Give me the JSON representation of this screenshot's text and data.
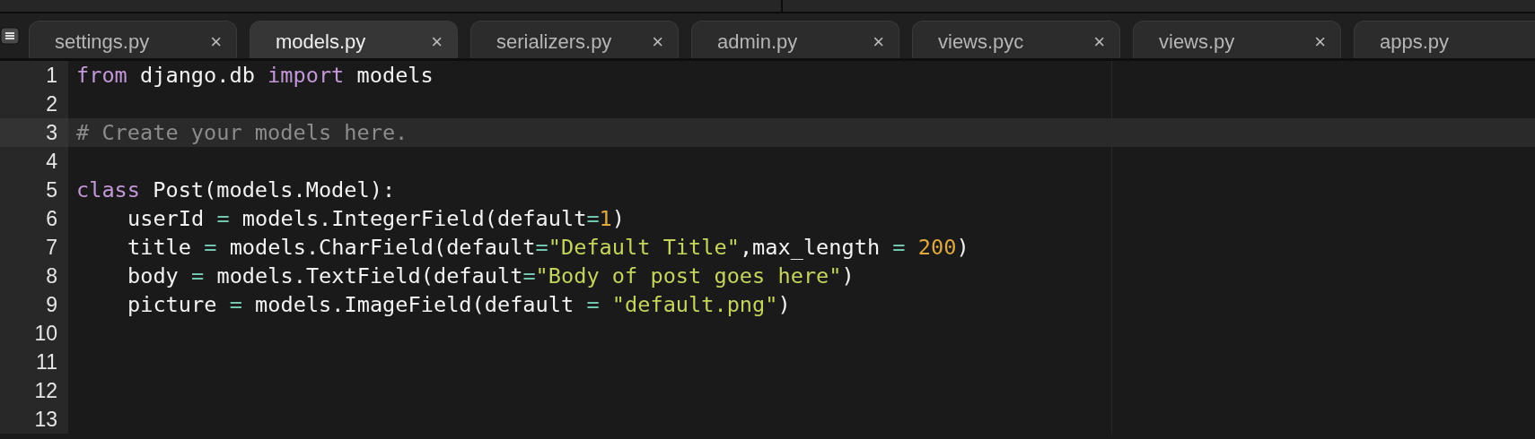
{
  "tabs": [
    {
      "label": "settings.py",
      "close": "×",
      "selected": false
    },
    {
      "label": "models.py",
      "close": "×",
      "selected": true
    },
    {
      "label": "serializers.py",
      "close": "×",
      "selected": false
    },
    {
      "label": "admin.py",
      "close": "×",
      "selected": false
    },
    {
      "label": "views.pyc",
      "close": "×",
      "selected": false
    },
    {
      "label": "views.py",
      "close": "×",
      "selected": false
    },
    {
      "label": "apps.py",
      "selected": false
    }
  ],
  "editor": {
    "lines": [
      {
        "number": "1",
        "current": false,
        "indented": false,
        "tokens": [
          {
            "kind": "keyword",
            "text": "from"
          },
          {
            "kind": "plain",
            "text": " django.db "
          },
          {
            "kind": "keyword",
            "text": "import"
          },
          {
            "kind": "plain",
            "text": " models"
          }
        ]
      },
      {
        "number": "2",
        "current": false
      },
      {
        "number": "3",
        "current": true,
        "indented": false,
        "tokens": [
          {
            "kind": "comment",
            "text": "# Create your models here."
          }
        ]
      },
      {
        "number": "4",
        "current": false
      },
      {
        "number": "5",
        "current": false,
        "indented": false,
        "tokens": [
          {
            "kind": "keyword",
            "text": "class"
          },
          {
            "kind": "plain",
            "text": " Post(models.Model):"
          }
        ]
      },
      {
        "number": "6",
        "current": false,
        "indented": true,
        "tokens": [
          {
            "kind": "plain",
            "text": "userId "
          },
          {
            "kind": "operator",
            "text": "="
          },
          {
            "kind": "plain",
            "text": " models.IntegerField(default"
          },
          {
            "kind": "operator",
            "text": "="
          },
          {
            "kind": "number",
            "text": "1"
          },
          {
            "kind": "plain",
            "text": ")"
          }
        ]
      },
      {
        "number": "7",
        "current": false,
        "indented": true,
        "tokens": [
          {
            "kind": "plain",
            "text": "title "
          },
          {
            "kind": "operator",
            "text": "="
          },
          {
            "kind": "plain",
            "text": " models.CharField(default"
          },
          {
            "kind": "operator",
            "text": "="
          },
          {
            "kind": "string",
            "text": "\"Default Title\""
          },
          {
            "kind": "plain",
            "text": ",max_length "
          },
          {
            "kind": "operator",
            "text": "= "
          },
          {
            "kind": "number",
            "text": "200"
          },
          {
            "kind": "plain",
            "text": ")"
          }
        ]
      },
      {
        "number": "8",
        "current": false,
        "indented": true,
        "tokens": [
          {
            "kind": "plain",
            "text": "body "
          },
          {
            "kind": "operator",
            "text": "="
          },
          {
            "kind": "plain",
            "text": " models.TextField(default"
          },
          {
            "kind": "operator",
            "text": "="
          },
          {
            "kind": "string",
            "text": "\"Body of post goes here\""
          },
          {
            "kind": "plain",
            "text": ")"
          }
        ]
      },
      {
        "number": "9",
        "current": false,
        "indented": true,
        "tokens": [
          {
            "kind": "plain",
            "text": "picture "
          },
          {
            "kind": "operator",
            "text": "="
          },
          {
            "kind": "plain",
            "text": " models.ImageField(default "
          },
          {
            "kind": "operator",
            "text": "= "
          },
          {
            "kind": "string",
            "text": "\"default.png\""
          },
          {
            "kind": "plain",
            "text": ")"
          }
        ]
      },
      {
        "number": "10",
        "current": false
      },
      {
        "number": "11",
        "current": false
      },
      {
        "number": "12",
        "current": false
      },
      {
        "number": "13",
        "current": false
      }
    ]
  }
}
